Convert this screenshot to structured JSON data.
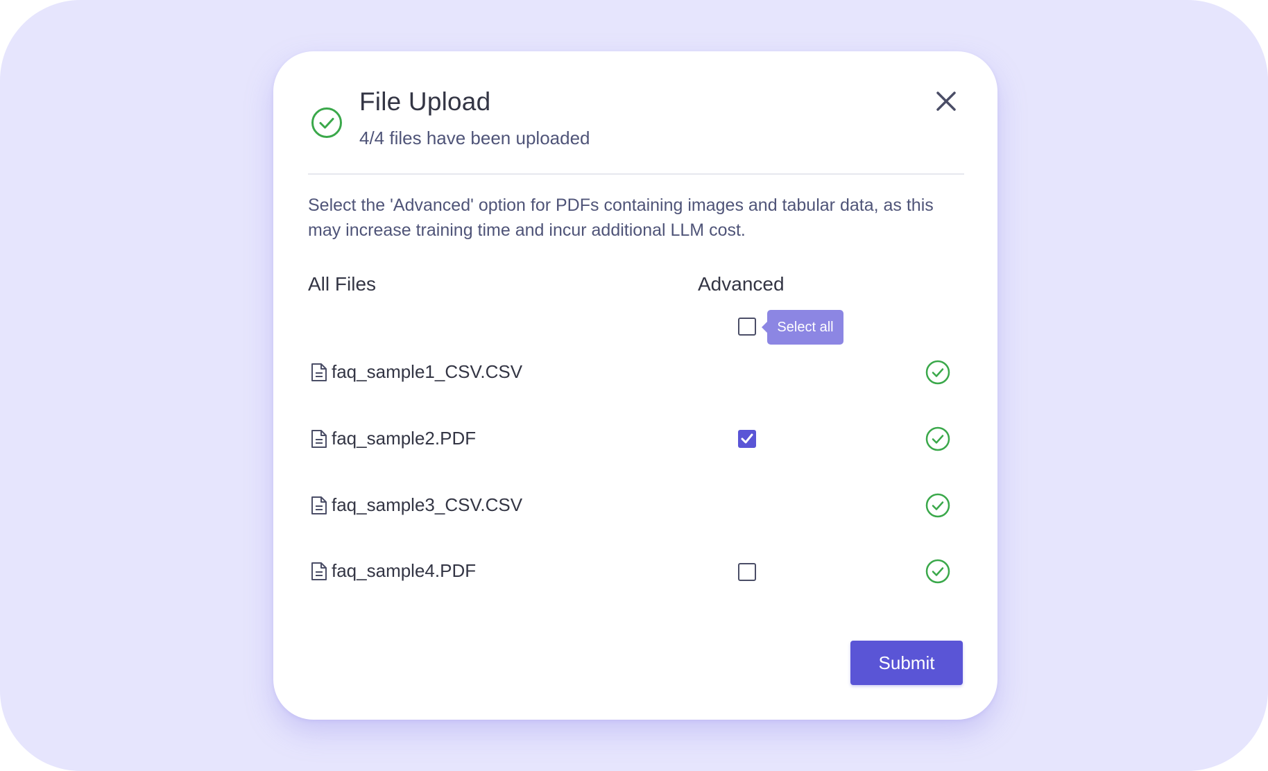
{
  "dialog": {
    "title": "File Upload",
    "subtitle": "4/4 files have been uploaded",
    "hint": "Select the 'Advanced' option for PDFs containing images and tabular data, as this may increase training time and incur additional LLM cost.",
    "upload_status_icon": "check-circle-icon",
    "close_icon": "close-icon"
  },
  "table": {
    "col_files": "All Files",
    "col_advanced": "Advanced",
    "select_all": {
      "checked": false,
      "tooltip": "Select all"
    },
    "files": [
      {
        "name": "faq_sample1_CSV.CSV",
        "has_advanced": false,
        "advanced_checked": false,
        "status": "uploaded"
      },
      {
        "name": "faq_sample2.PDF",
        "has_advanced": true,
        "advanced_checked": true,
        "status": "uploaded"
      },
      {
        "name": "faq_sample3_CSV.CSV",
        "has_advanced": false,
        "advanced_checked": false,
        "status": "uploaded"
      },
      {
        "name": "faq_sample4.PDF",
        "has_advanced": true,
        "advanced_checked": false,
        "status": "uploaded"
      }
    ]
  },
  "actions": {
    "submit_label": "Submit"
  },
  "colors": {
    "background": "#e6e5fd",
    "accent": "#5a55d6",
    "tooltip": "#8c86e3",
    "success": "#3aa84a",
    "text_primary": "#333544",
    "text_secondary": "#4f5478"
  }
}
